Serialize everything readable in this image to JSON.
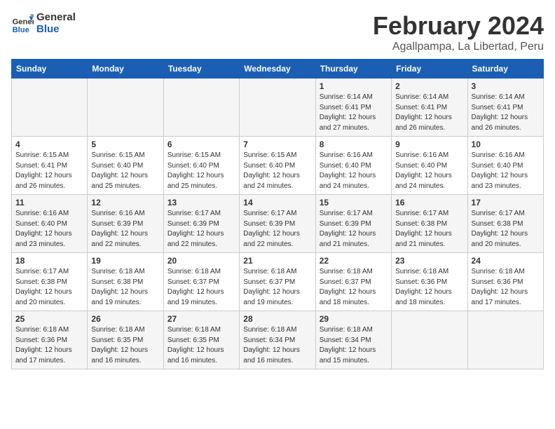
{
  "logo": {
    "line1": "General",
    "line2": "Blue"
  },
  "title": "February 2024",
  "subtitle": "Agallpampa, La Libertad, Peru",
  "days_of_week": [
    "Sunday",
    "Monday",
    "Tuesday",
    "Wednesday",
    "Thursday",
    "Friday",
    "Saturday"
  ],
  "weeks": [
    [
      {
        "day": "",
        "info": ""
      },
      {
        "day": "",
        "info": ""
      },
      {
        "day": "",
        "info": ""
      },
      {
        "day": "",
        "info": ""
      },
      {
        "day": "1",
        "info": "Sunrise: 6:14 AM\nSunset: 6:41 PM\nDaylight: 12 hours\nand 27 minutes."
      },
      {
        "day": "2",
        "info": "Sunrise: 6:14 AM\nSunset: 6:41 PM\nDaylight: 12 hours\nand 26 minutes."
      },
      {
        "day": "3",
        "info": "Sunrise: 6:14 AM\nSunset: 6:41 PM\nDaylight: 12 hours\nand 26 minutes."
      }
    ],
    [
      {
        "day": "4",
        "info": "Sunrise: 6:15 AM\nSunset: 6:41 PM\nDaylight: 12 hours\nand 26 minutes."
      },
      {
        "day": "5",
        "info": "Sunrise: 6:15 AM\nSunset: 6:40 PM\nDaylight: 12 hours\nand 25 minutes."
      },
      {
        "day": "6",
        "info": "Sunrise: 6:15 AM\nSunset: 6:40 PM\nDaylight: 12 hours\nand 25 minutes."
      },
      {
        "day": "7",
        "info": "Sunrise: 6:15 AM\nSunset: 6:40 PM\nDaylight: 12 hours\nand 24 minutes."
      },
      {
        "day": "8",
        "info": "Sunrise: 6:16 AM\nSunset: 6:40 PM\nDaylight: 12 hours\nand 24 minutes."
      },
      {
        "day": "9",
        "info": "Sunrise: 6:16 AM\nSunset: 6:40 PM\nDaylight: 12 hours\nand 24 minutes."
      },
      {
        "day": "10",
        "info": "Sunrise: 6:16 AM\nSunset: 6:40 PM\nDaylight: 12 hours\nand 23 minutes."
      }
    ],
    [
      {
        "day": "11",
        "info": "Sunrise: 6:16 AM\nSunset: 6:40 PM\nDaylight: 12 hours\nand 23 minutes."
      },
      {
        "day": "12",
        "info": "Sunrise: 6:16 AM\nSunset: 6:39 PM\nDaylight: 12 hours\nand 22 minutes."
      },
      {
        "day": "13",
        "info": "Sunrise: 6:17 AM\nSunset: 6:39 PM\nDaylight: 12 hours\nand 22 minutes."
      },
      {
        "day": "14",
        "info": "Sunrise: 6:17 AM\nSunset: 6:39 PM\nDaylight: 12 hours\nand 22 minutes."
      },
      {
        "day": "15",
        "info": "Sunrise: 6:17 AM\nSunset: 6:39 PM\nDaylight: 12 hours\nand 21 minutes."
      },
      {
        "day": "16",
        "info": "Sunrise: 6:17 AM\nSunset: 6:38 PM\nDaylight: 12 hours\nand 21 minutes."
      },
      {
        "day": "17",
        "info": "Sunrise: 6:17 AM\nSunset: 6:38 PM\nDaylight: 12 hours\nand 20 minutes."
      }
    ],
    [
      {
        "day": "18",
        "info": "Sunrise: 6:17 AM\nSunset: 6:38 PM\nDaylight: 12 hours\nand 20 minutes."
      },
      {
        "day": "19",
        "info": "Sunrise: 6:18 AM\nSunset: 6:38 PM\nDaylight: 12 hours\nand 19 minutes."
      },
      {
        "day": "20",
        "info": "Sunrise: 6:18 AM\nSunset: 6:37 PM\nDaylight: 12 hours\nand 19 minutes."
      },
      {
        "day": "21",
        "info": "Sunrise: 6:18 AM\nSunset: 6:37 PM\nDaylight: 12 hours\nand 19 minutes."
      },
      {
        "day": "22",
        "info": "Sunrise: 6:18 AM\nSunset: 6:37 PM\nDaylight: 12 hours\nand 18 minutes."
      },
      {
        "day": "23",
        "info": "Sunrise: 6:18 AM\nSunset: 6:36 PM\nDaylight: 12 hours\nand 18 minutes."
      },
      {
        "day": "24",
        "info": "Sunrise: 6:18 AM\nSunset: 6:36 PM\nDaylight: 12 hours\nand 17 minutes."
      }
    ],
    [
      {
        "day": "25",
        "info": "Sunrise: 6:18 AM\nSunset: 6:36 PM\nDaylight: 12 hours\nand 17 minutes."
      },
      {
        "day": "26",
        "info": "Sunrise: 6:18 AM\nSunset: 6:35 PM\nDaylight: 12 hours\nand 16 minutes."
      },
      {
        "day": "27",
        "info": "Sunrise: 6:18 AM\nSunset: 6:35 PM\nDaylight: 12 hours\nand 16 minutes."
      },
      {
        "day": "28",
        "info": "Sunrise: 6:18 AM\nSunset: 6:34 PM\nDaylight: 12 hours\nand 16 minutes."
      },
      {
        "day": "29",
        "info": "Sunrise: 6:18 AM\nSunset: 6:34 PM\nDaylight: 12 hours\nand 15 minutes."
      },
      {
        "day": "",
        "info": ""
      },
      {
        "day": "",
        "info": ""
      }
    ]
  ]
}
